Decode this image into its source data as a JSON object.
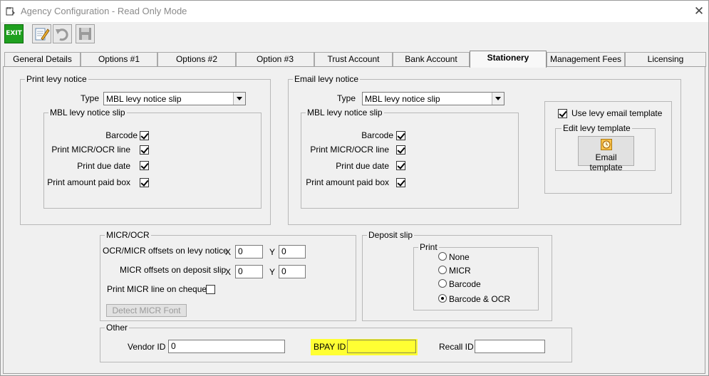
{
  "window": {
    "title": "Agency Configuration - Read Only Mode",
    "close_glyph": "✕"
  },
  "toolbar": {
    "exit_label": "EXIT",
    "icons": [
      "edit-icon",
      "undo-icon",
      "save-icon"
    ]
  },
  "tabs": [
    {
      "label": "General Details",
      "active": false
    },
    {
      "label": "Options #1",
      "active": false
    },
    {
      "label": "Options #2",
      "active": false
    },
    {
      "label": "Option #3",
      "active": false
    },
    {
      "label": "Trust Account",
      "active": false
    },
    {
      "label": "Bank Account",
      "active": false
    },
    {
      "label": "Stationery",
      "active": true
    },
    {
      "label": "Management Fees",
      "active": false
    },
    {
      "label": "Licensing",
      "active": false
    }
  ],
  "print_levy": {
    "title": "Print levy notice",
    "type_label": "Type",
    "type_value": "MBL levy notice slip",
    "slip_title": "MBL levy notice slip",
    "options": [
      {
        "label": "Barcode",
        "checked": true
      },
      {
        "label": "Print MICR/OCR line",
        "checked": true
      },
      {
        "label": "Print due date",
        "checked": true
      },
      {
        "label": "Print amount paid box",
        "checked": true
      }
    ]
  },
  "email_levy": {
    "title": "Email levy notice",
    "type_label": "Type",
    "type_value": "MBL levy notice slip",
    "slip_title": "MBL levy notice slip",
    "options": [
      {
        "label": "Barcode",
        "checked": true
      },
      {
        "label": "Print MICR/OCR line",
        "checked": true
      },
      {
        "label": "Print due date",
        "checked": true
      },
      {
        "label": "Print amount paid box",
        "checked": true
      }
    ],
    "use_template_label": "Use levy email template",
    "use_template_checked": true,
    "edit_template_title": "Edit levy template",
    "email_template_button": "Email template"
  },
  "micr_ocr": {
    "title": "MICR/OCR",
    "levy_offsets_label": "OCR/MICR offsets on levy notice",
    "deposit_offsets_label": "MICR offsets on deposit slip",
    "x_label": "X",
    "y_label": "Y",
    "levy_x": "0",
    "levy_y": "0",
    "deposit_x": "0",
    "deposit_y": "0",
    "print_on_cheques_label": "Print MICR line on cheques",
    "print_on_cheques_checked": false,
    "detect_button": "Detect MICR Font"
  },
  "deposit_slip": {
    "title": "Deposit slip",
    "print_title": "Print",
    "options": [
      {
        "label": "None",
        "selected": false
      },
      {
        "label": "MICR",
        "selected": false
      },
      {
        "label": "Barcode",
        "selected": false
      },
      {
        "label": "Barcode & OCR",
        "selected": true
      }
    ]
  },
  "other": {
    "title": "Other",
    "vendor_label": "Vendor ID",
    "vendor_value": "0",
    "bpay_label": "BPAY ID",
    "bpay_value": "",
    "recall_label": "Recall ID",
    "recall_value": "",
    "highlight_color": "#ffff33"
  }
}
